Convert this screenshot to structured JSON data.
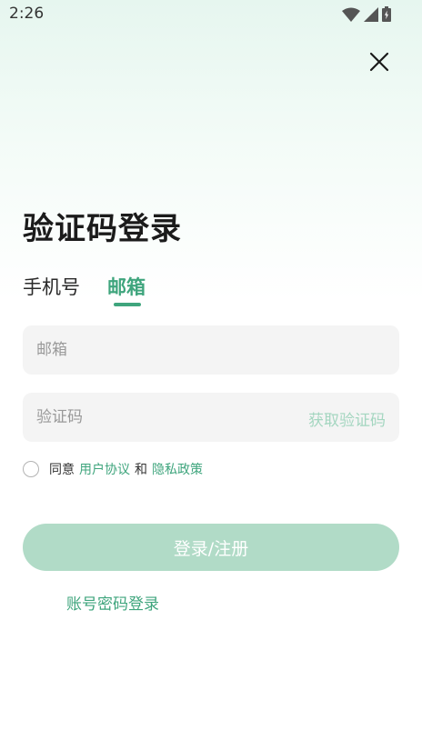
{
  "status_bar": {
    "time": "2:26"
  },
  "header": {
    "title": "验证码登录"
  },
  "tabs": [
    {
      "label": "手机号",
      "active": false
    },
    {
      "label": "邮箱",
      "active": true
    }
  ],
  "form": {
    "email": {
      "placeholder": "邮箱",
      "value": ""
    },
    "code": {
      "placeholder": "验证码",
      "value": "",
      "get_code_label": "获取验证码"
    }
  },
  "agreement": {
    "prefix": "同意",
    "user_agreement": "用户协议",
    "conjunction": "和",
    "privacy_policy": "隐私政策",
    "checked": false
  },
  "actions": {
    "login_label": "登录/注册",
    "password_login_label": "账号密码登录"
  },
  "colors": {
    "accent": "#3fa57d",
    "button_disabled": "#b1dbc7",
    "field_bg": "#f4f4f4"
  },
  "icons": {
    "close": "close-icon",
    "wifi": "wifi-icon",
    "signal": "signal-icon",
    "battery": "battery-icon"
  }
}
